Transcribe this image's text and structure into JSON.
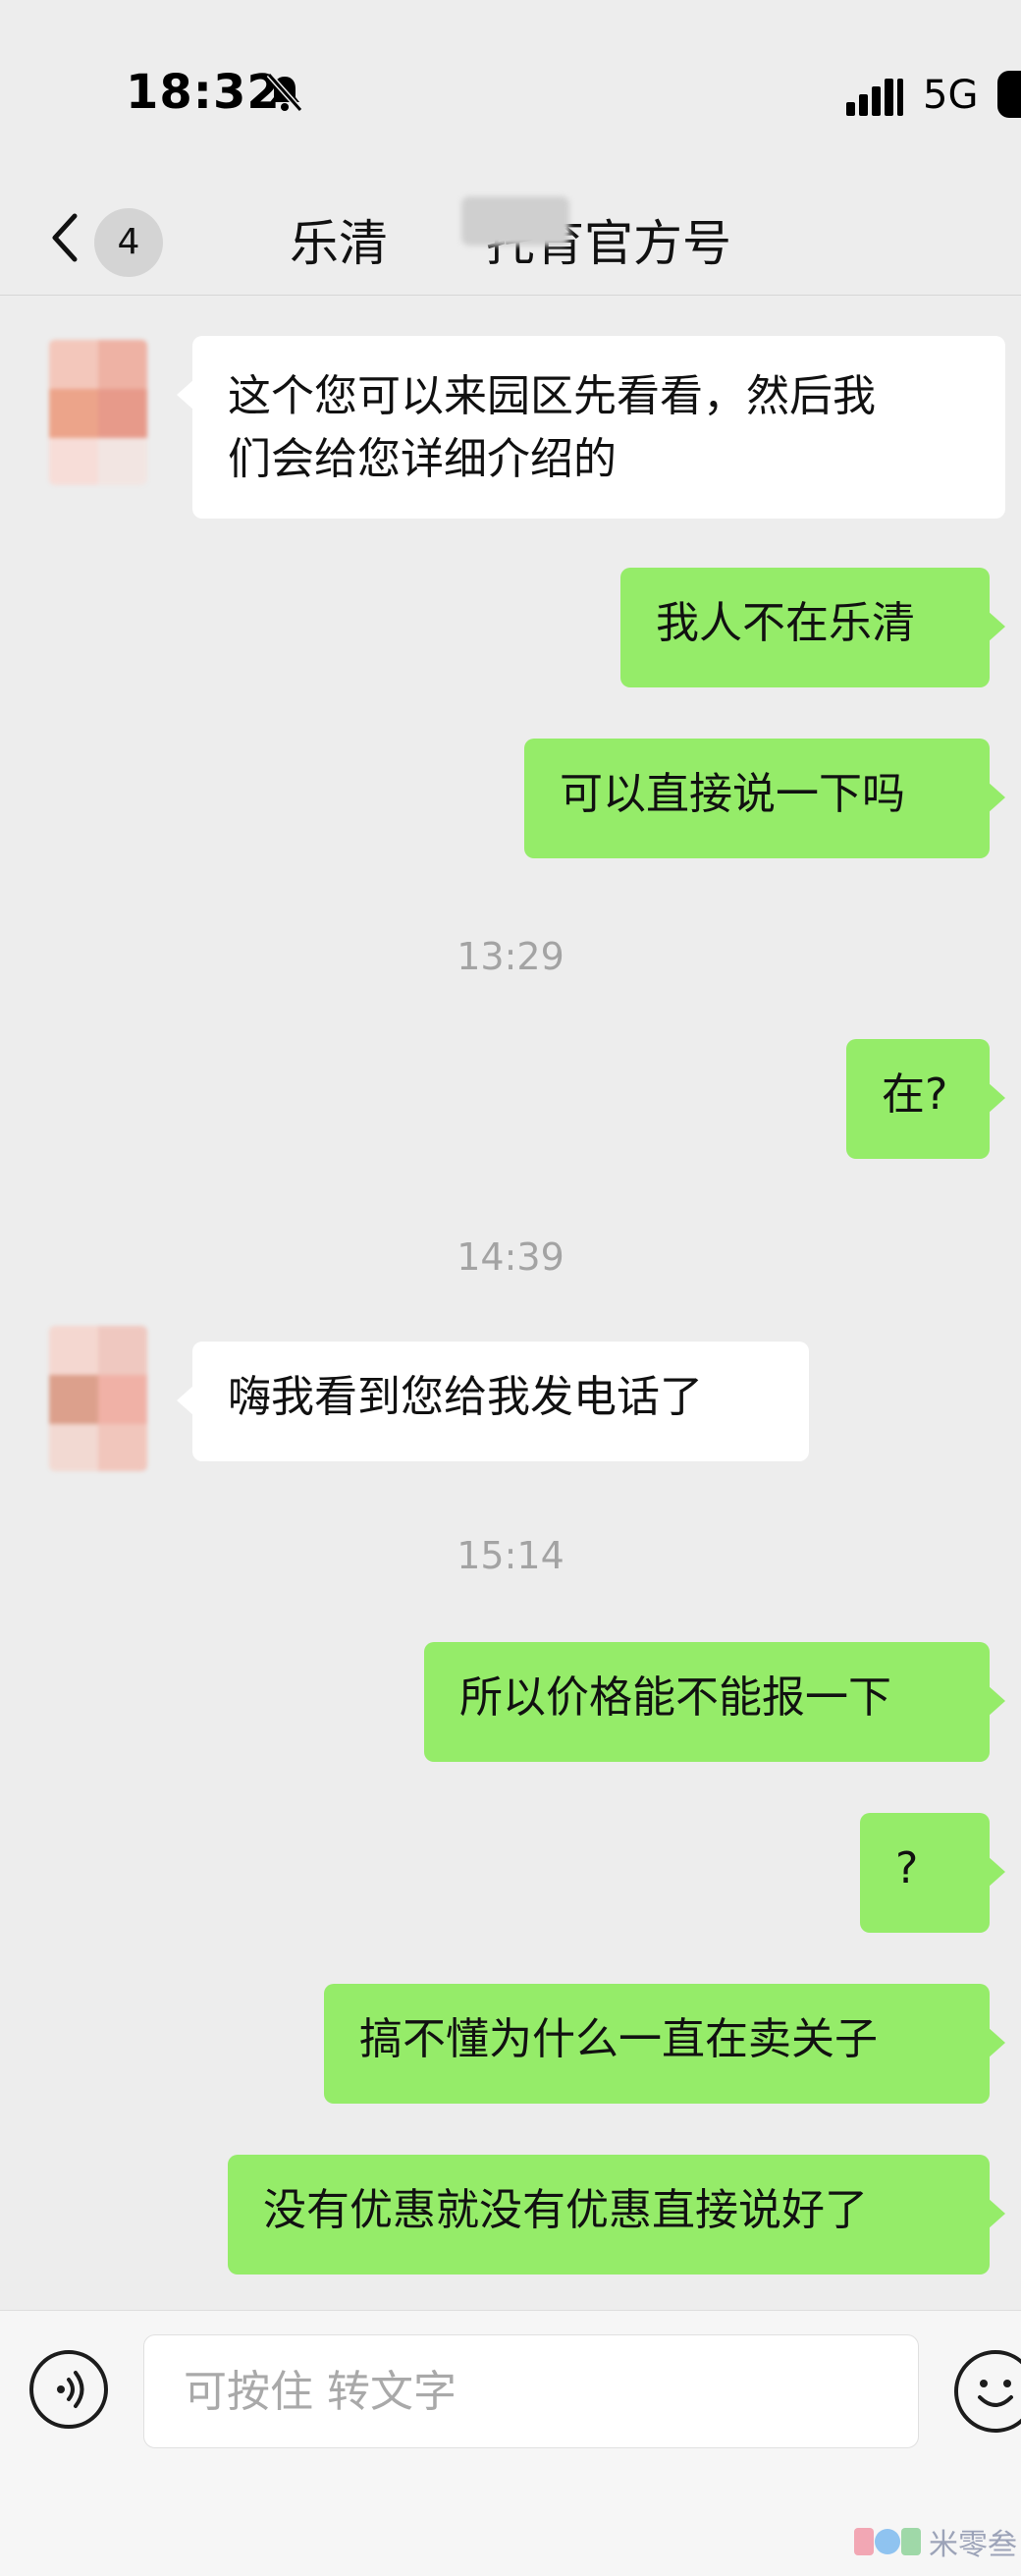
{
  "status_bar": {
    "time": "18:32",
    "network": "5G",
    "icons": [
      "bell-slash-icon",
      "signal-icon",
      "battery-icon"
    ]
  },
  "header": {
    "back_icon": "chevron-left-icon",
    "unread_count": "4",
    "title": "乐清　　托育官方号"
  },
  "messages": [
    {
      "side": "in",
      "text_line1": "这个您可以来园区先看看，然后我",
      "text_line2": "们会给您详细介绍的"
    },
    {
      "side": "out",
      "text": "我人不在乐清"
    },
    {
      "side": "out",
      "text": "可以直接说一下吗"
    },
    {
      "type": "time",
      "text": "13:29"
    },
    {
      "side": "out",
      "text": "在?"
    },
    {
      "type": "time",
      "text": "14:39"
    },
    {
      "side": "in",
      "text": "嗨我看到您给我发电话了"
    },
    {
      "type": "time",
      "text": "15:14"
    },
    {
      "side": "out",
      "text": "所以价格能不能报一下"
    },
    {
      "side": "out",
      "text": "?"
    },
    {
      "side": "out",
      "text": "搞不懂为什么一直在卖关子"
    },
    {
      "side": "out",
      "text": "没有优惠就没有优惠直接说好了"
    }
  ],
  "input_bar": {
    "placeholder": "可按住 转文字",
    "voice_icon": "voice-icon",
    "emoji_icon": "emoji-icon"
  },
  "watermark": {
    "text": "米零叁"
  },
  "colors": {
    "background": "#ededed",
    "outgoing_bubble": "#95ec69",
    "incoming_bubble": "#ffffff"
  }
}
